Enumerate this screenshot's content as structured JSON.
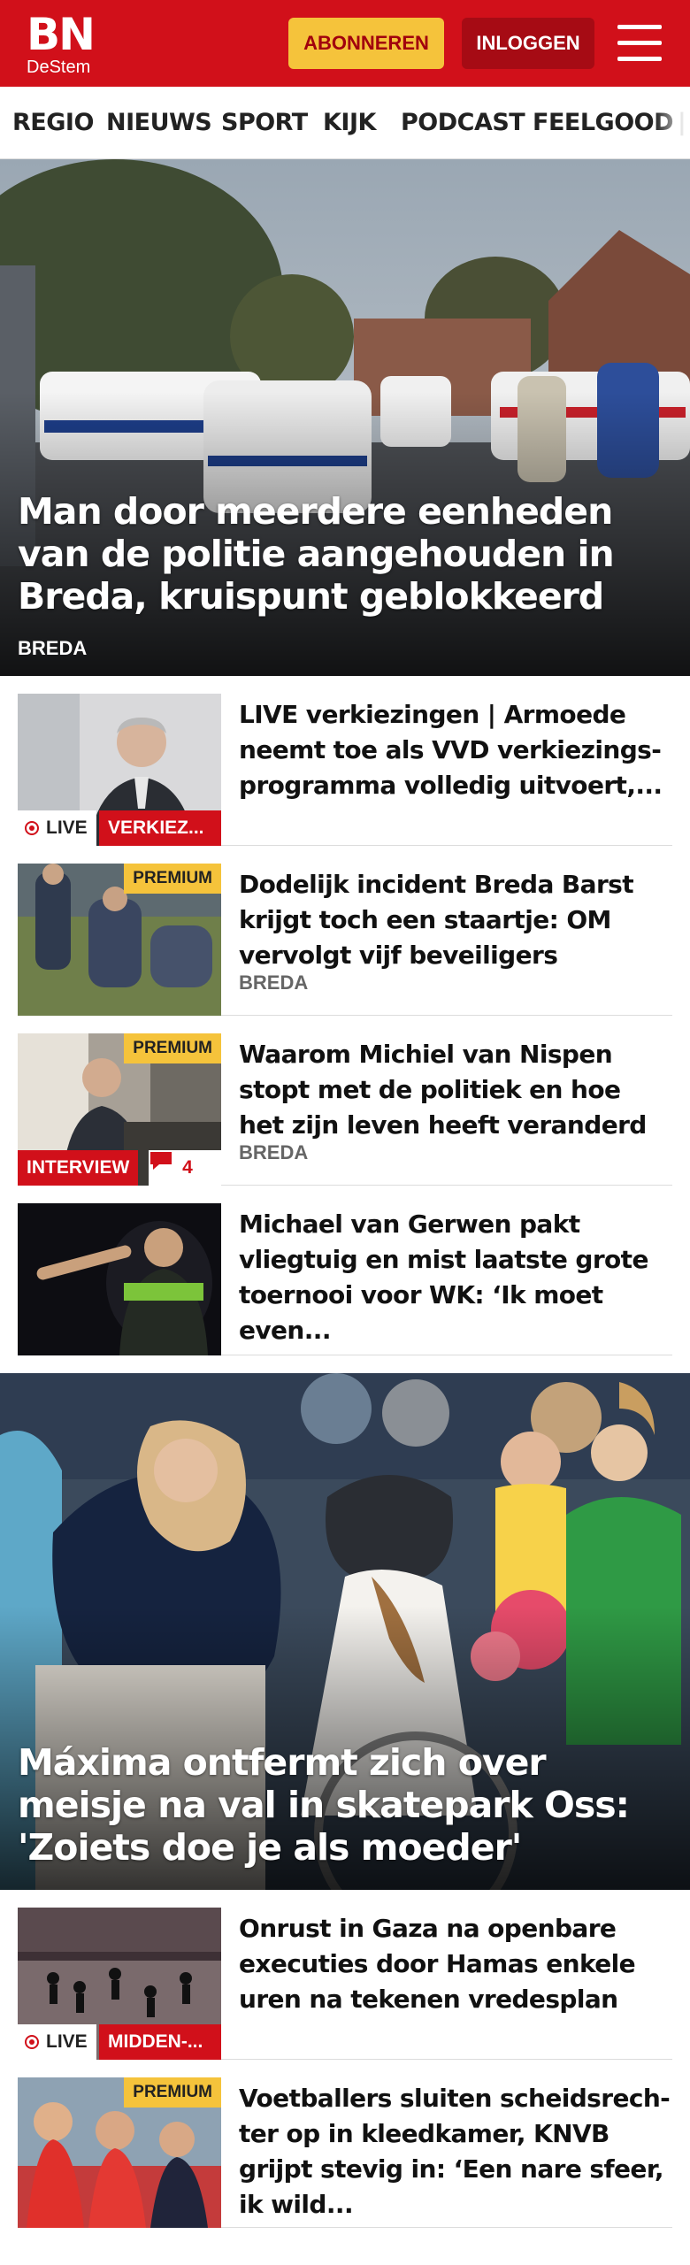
{
  "header": {
    "logo_main": "BN",
    "logo_sub": "DeStem",
    "subscribe_label": "ABONNEREN",
    "login_label": "INLOGGEN",
    "menu_icon": "hamburger-menu-icon",
    "colors": {
      "brand_red": "#d1101a",
      "subscribe_yellow": "#f5c33b",
      "login_dark_red": "#a60b14"
    }
  },
  "nav": {
    "items": [
      "REGIO",
      "NIEUWS",
      "SPORT",
      "KIJK",
      "PODCAST",
      "FEELGOOD"
    ]
  },
  "hero1": {
    "title": "Man door meerdere eenheden van de politie aangehouden in Breda, kruispunt geblokkeerd",
    "tag": "BREDA"
  },
  "teasers1": [
    {
      "title": "LIVE verkiezingen | Armoede neemt toe als VVD verkiezings-programma volledig uitvoert,...",
      "live_label": "LIVE",
      "category": "VERKIEZ..."
    },
    {
      "title": "Dodelijk incident Breda Barst krijgt toch een staartje: OM vervolgt vijf beveiligers",
      "premium": "PREMIUM",
      "tag": "BREDA"
    },
    {
      "title": "Waarom Michiel van Nispen stopt met de politiek en hoe het zijn leven heeft veranderd",
      "premium": "PREMIUM",
      "interview": "INTERVIEW",
      "comments": "4",
      "tag": "BREDA"
    },
    {
      "title": "Michael van Gerwen pakt vliegtuig en mist laatste grote toernooi voor WK: ‘Ik moet even..."
    }
  ],
  "hero2": {
    "title": "Máxima ontfermt zich over meisje na val in skatepark Oss: 'Zoiets doe je als moeder'"
  },
  "teasers2": [
    {
      "title": "Onrust in Gaza na openbare executies door Hamas enkele uren na tekenen vredesplan",
      "live_label": "LIVE",
      "category": "MIDDEN-..."
    },
    {
      "title": "Voetballers sluiten scheidsrech-ter op in kleedkamer, KNVB grijpt stevig in: ‘Een nare sfeer, ik wild...",
      "premium": "PREMIUM"
    }
  ]
}
